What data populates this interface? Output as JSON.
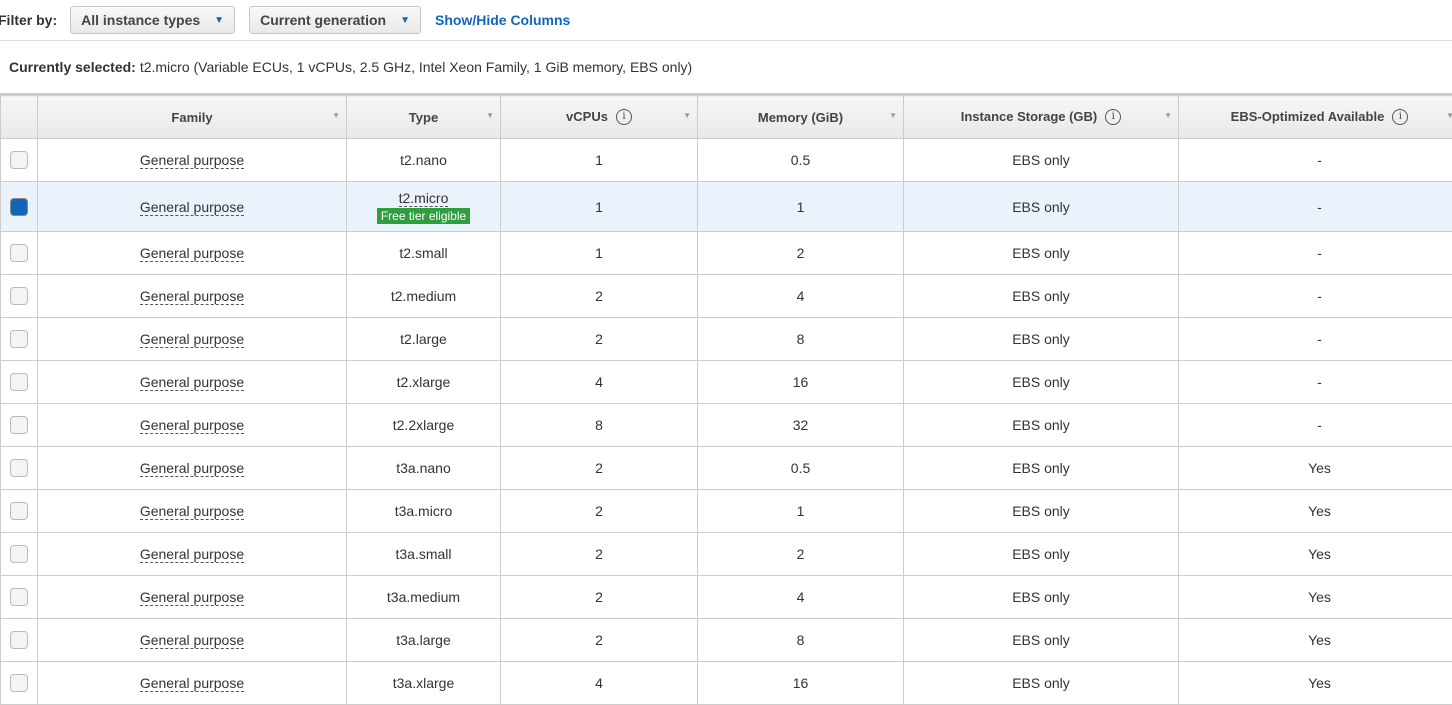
{
  "filter": {
    "label": "Filter by:",
    "instance_types": "All instance types",
    "generation": "Current generation",
    "show_hide": "Show/Hide Columns"
  },
  "current": {
    "label": "Currently selected:",
    "value": "t2.micro (Variable ECUs, 1 vCPUs, 2.5 GHz, Intel Xeon Family, 1 GiB memory, EBS only)"
  },
  "columns": [
    "Family",
    "Type",
    "vCPUs",
    "Memory (GiB)",
    "Instance Storage (GB)",
    "EBS-Optimized Available"
  ],
  "free_tier_label": "Free tier eligible",
  "rows": [
    {
      "family": "General purpose",
      "type": "t2.nano",
      "vcpus": "1",
      "memory": "0.5",
      "storage": "EBS only",
      "ebs": "-",
      "selected": false
    },
    {
      "family": "General purpose",
      "type": "t2.micro",
      "vcpus": "1",
      "memory": "1",
      "storage": "EBS only",
      "ebs": "-",
      "selected": true,
      "free": true
    },
    {
      "family": "General purpose",
      "type": "t2.small",
      "vcpus": "1",
      "memory": "2",
      "storage": "EBS only",
      "ebs": "-",
      "selected": false
    },
    {
      "family": "General purpose",
      "type": "t2.medium",
      "vcpus": "2",
      "memory": "4",
      "storage": "EBS only",
      "ebs": "-",
      "selected": false
    },
    {
      "family": "General purpose",
      "type": "t2.large",
      "vcpus": "2",
      "memory": "8",
      "storage": "EBS only",
      "ebs": "-",
      "selected": false
    },
    {
      "family": "General purpose",
      "type": "t2.xlarge",
      "vcpus": "4",
      "memory": "16",
      "storage": "EBS only",
      "ebs": "-",
      "selected": false
    },
    {
      "family": "General purpose",
      "type": "t2.2xlarge",
      "vcpus": "8",
      "memory": "32",
      "storage": "EBS only",
      "ebs": "-",
      "selected": false
    },
    {
      "family": "General purpose",
      "type": "t3a.nano",
      "vcpus": "2",
      "memory": "0.5",
      "storage": "EBS only",
      "ebs": "Yes",
      "selected": false
    },
    {
      "family": "General purpose",
      "type": "t3a.micro",
      "vcpus": "2",
      "memory": "1",
      "storage": "EBS only",
      "ebs": "Yes",
      "selected": false
    },
    {
      "family": "General purpose",
      "type": "t3a.small",
      "vcpus": "2",
      "memory": "2",
      "storage": "EBS only",
      "ebs": "Yes",
      "selected": false
    },
    {
      "family": "General purpose",
      "type": "t3a.medium",
      "vcpus": "2",
      "memory": "4",
      "storage": "EBS only",
      "ebs": "Yes",
      "selected": false
    },
    {
      "family": "General purpose",
      "type": "t3a.large",
      "vcpus": "2",
      "memory": "8",
      "storage": "EBS only",
      "ebs": "Yes",
      "selected": false
    },
    {
      "family": "General purpose",
      "type": "t3a.xlarge",
      "vcpus": "4",
      "memory": "16",
      "storage": "EBS only",
      "ebs": "Yes",
      "selected": false
    }
  ],
  "colors": {
    "link": "#1166bb",
    "selected_row": "#eaf2fc",
    "free_tier": "#2e9e3f"
  }
}
